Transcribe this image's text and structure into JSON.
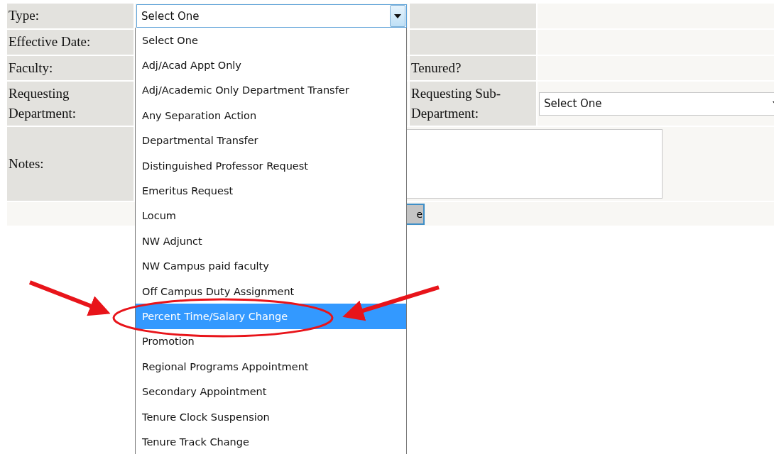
{
  "form": {
    "type": {
      "label": "Type:",
      "value": "Select One",
      "expanded": true
    },
    "effective_date": {
      "label": "Effective Date:"
    },
    "faculty": {
      "label": "Faculty:"
    },
    "tenured": {
      "label": "Tenured?"
    },
    "requesting_department": {
      "label": "Requesting Department:"
    },
    "sub_department": {
      "label": "Requesting Sub-Department:",
      "value": "Select One"
    },
    "notes": {
      "label": "Notes:"
    },
    "button": {
      "label": "e"
    }
  },
  "dropdown": {
    "options": [
      {
        "label": "Select One",
        "selected": false
      },
      {
        "label": "Adj/Acad Appt Only",
        "selected": false
      },
      {
        "label": "Adj/Academic Only Department Transfer",
        "selected": false
      },
      {
        "label": "Any Separation Action",
        "selected": false
      },
      {
        "label": "Departmental Transfer",
        "selected": false
      },
      {
        "label": "Distinguished Professor Request",
        "selected": false
      },
      {
        "label": "Emeritus Request",
        "selected": false
      },
      {
        "label": "Locum",
        "selected": false
      },
      {
        "label": "NW Adjunct",
        "selected": false
      },
      {
        "label": "NW Campus paid faculty",
        "selected": false
      },
      {
        "label": "Off Campus Duty Assignment",
        "selected": false
      },
      {
        "label": "Percent Time/Salary Change",
        "selected": true
      },
      {
        "label": "Promotion",
        "selected": false
      },
      {
        "label": "Regional Programs Appointment",
        "selected": false
      },
      {
        "label": "Secondary Appointment",
        "selected": false
      },
      {
        "label": "Tenure Clock Suspension",
        "selected": false
      },
      {
        "label": "Tenure Track Change",
        "selected": false
      }
    ]
  }
}
